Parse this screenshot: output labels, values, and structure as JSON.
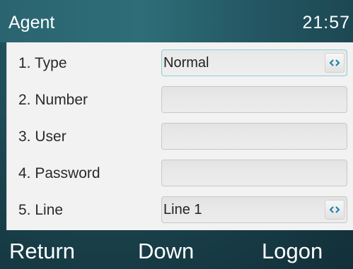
{
  "header": {
    "title": "Agent",
    "time": "21:57"
  },
  "form": {
    "rows": [
      {
        "label": "1.  Type",
        "value": "Normal",
        "has_selector": true
      },
      {
        "label": "2.  Number",
        "value": "",
        "has_selector": false
      },
      {
        "label": "3.  User",
        "value": "",
        "has_selector": false
      },
      {
        "label": "4.  Password",
        "value": "",
        "has_selector": false
      },
      {
        "label": "5.  Line",
        "value": "Line 1",
        "has_selector": true
      }
    ],
    "selector_icon": "left-right-chevron-icon"
  },
  "softkeys": {
    "left": "Return",
    "middle": "Down",
    "right": "Logon"
  },
  "colors": {
    "header_bg": "#2a6470",
    "panel_bg": "#f2f2f2",
    "focus_border": "#8fcdd6",
    "chevron": "#1a7fa8"
  }
}
